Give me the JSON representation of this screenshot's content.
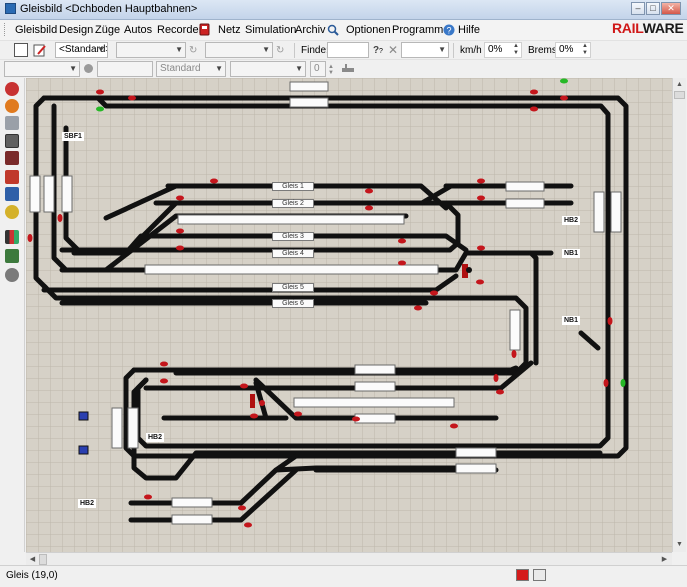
{
  "window": {
    "title": "Gleisbild <Dchboden Hauptbahnen>"
  },
  "menu": {
    "items": [
      "Gleisbild",
      "Design",
      "Züge",
      "Autos",
      "Recorder",
      "Netz",
      "Simulation",
      "Archiv",
      "Optionen",
      "Programme",
      "Hilfe"
    ],
    "logo_rail": "RAIL",
    "logo_ware": "WARE"
  },
  "toolbar1": {
    "view_combo": "<Standard>",
    "find_label": "Finde:",
    "find_value": "",
    "speed_unit": "km/h",
    "speed_value": "0%",
    "brake_label": "Brems",
    "brake_value": "0%"
  },
  "toolbar2": {
    "style_combo": "Standard",
    "number_value": "0"
  },
  "tracks": {
    "gleis_labels": [
      "Gleis 1",
      "Gleis 2",
      "Gleis 3",
      "Gleis 4",
      "Gleis 5",
      "Gleis 6"
    ],
    "station_tags": [
      "SBF1",
      "HB2",
      "NB1",
      "NB1",
      "HB2",
      "HB2"
    ]
  },
  "status": {
    "text": "Gleis (19,0)"
  },
  "colors": {
    "canvas": "#d6d1c7",
    "grid": "#bdb7ab",
    "track": "#111111",
    "signal_red": "#c4161c",
    "signal_green": "#26b826",
    "accent": "#d01818"
  },
  "icons": {
    "menu": [
      "recorder-icon",
      "search-icon",
      "help-icon"
    ],
    "toolbar": [
      "open-icon",
      "edit-icon",
      "question-icon",
      "cancel-icon"
    ],
    "palette": [
      "power-icon",
      "signal-icon",
      "sound-icon",
      "tool-icon",
      "train-icon",
      "route-icon",
      "group-icon",
      "chart-icon",
      "table-icon",
      "settings-icon"
    ]
  }
}
